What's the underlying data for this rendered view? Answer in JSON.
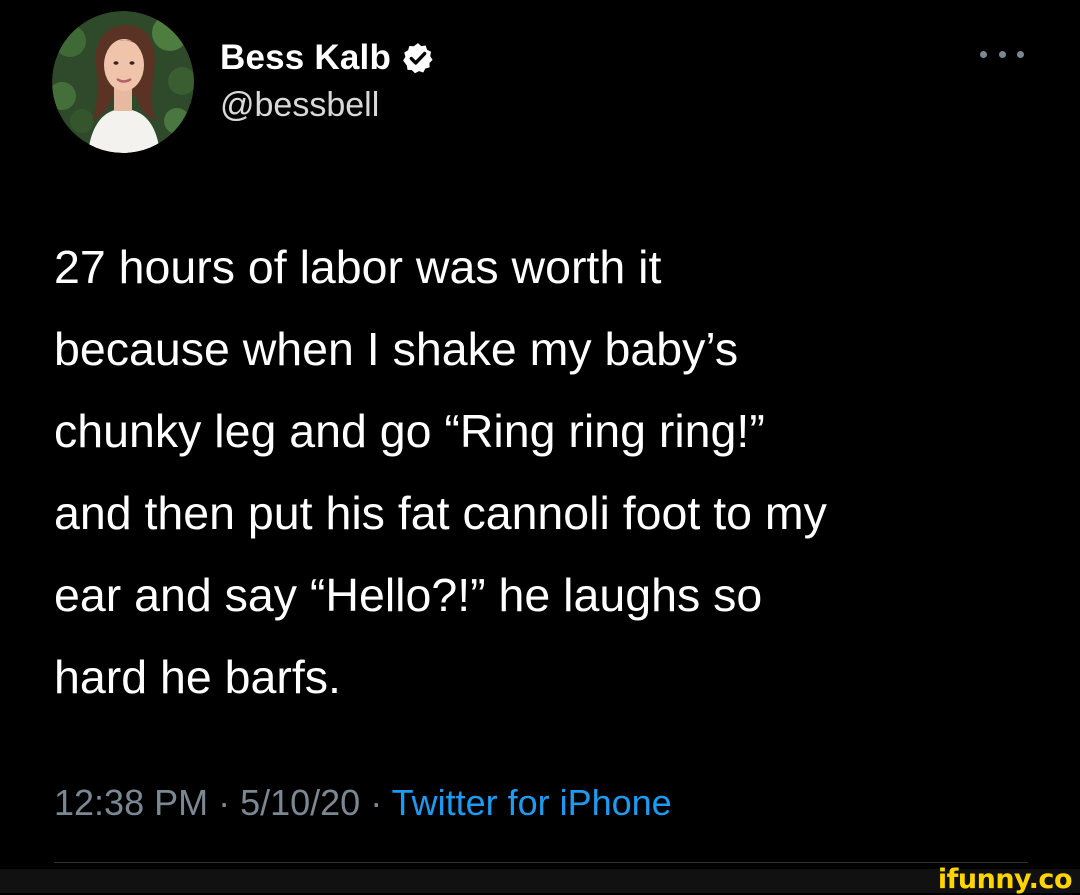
{
  "author": {
    "display_name": "Bess Kalb",
    "handle": "@bessbell",
    "verified": true,
    "avatar_icon": "profile-photo"
  },
  "tweet": {
    "text": "27 hours of labor was worth it\nbecause when I shake my baby’s\nchunky leg and go “Ring ring ring!”\nand then put his fat cannoli foot to my\near and say “Hello?!” he laughs so\nhard he barfs."
  },
  "meta": {
    "time": "12:38 PM",
    "separator": " · ",
    "date": "5/10/20",
    "source": "Twitter for iPhone"
  },
  "icons": {
    "more": "more-horizontal-icon",
    "verified": "verified-badge-icon"
  },
  "colors": {
    "background": "#000000",
    "text": "#ffffff",
    "secondary": "#7b8894",
    "link": "#1d9bf0",
    "verified": "#ffffff",
    "watermark": "#ffd500"
  },
  "watermark": {
    "text": "ifunny.co"
  }
}
